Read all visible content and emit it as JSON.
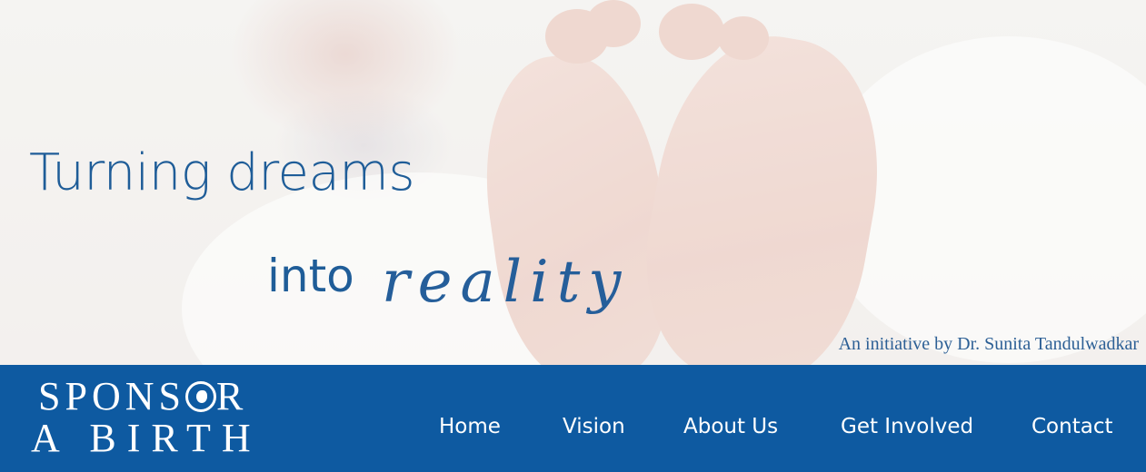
{
  "hero": {
    "headline_line1": "Turning dreams",
    "headline_into": "into",
    "headline_script": "reality",
    "initiative": "An initiative by Dr. Sunita Tandulwadkar"
  },
  "logo": {
    "line1_a": "SPONS",
    "line1_b": "R",
    "line2": "A BIRTH",
    "icon": "embryo-icon"
  },
  "nav": {
    "items": [
      {
        "label": "Home"
      },
      {
        "label": "Vision"
      },
      {
        "label": "About Us"
      },
      {
        "label": "Get Involved"
      },
      {
        "label": "Contact"
      }
    ]
  },
  "colors": {
    "brand_blue": "#0e5aa1",
    "headline_blue": "#1f5d98",
    "white": "#ffffff"
  }
}
